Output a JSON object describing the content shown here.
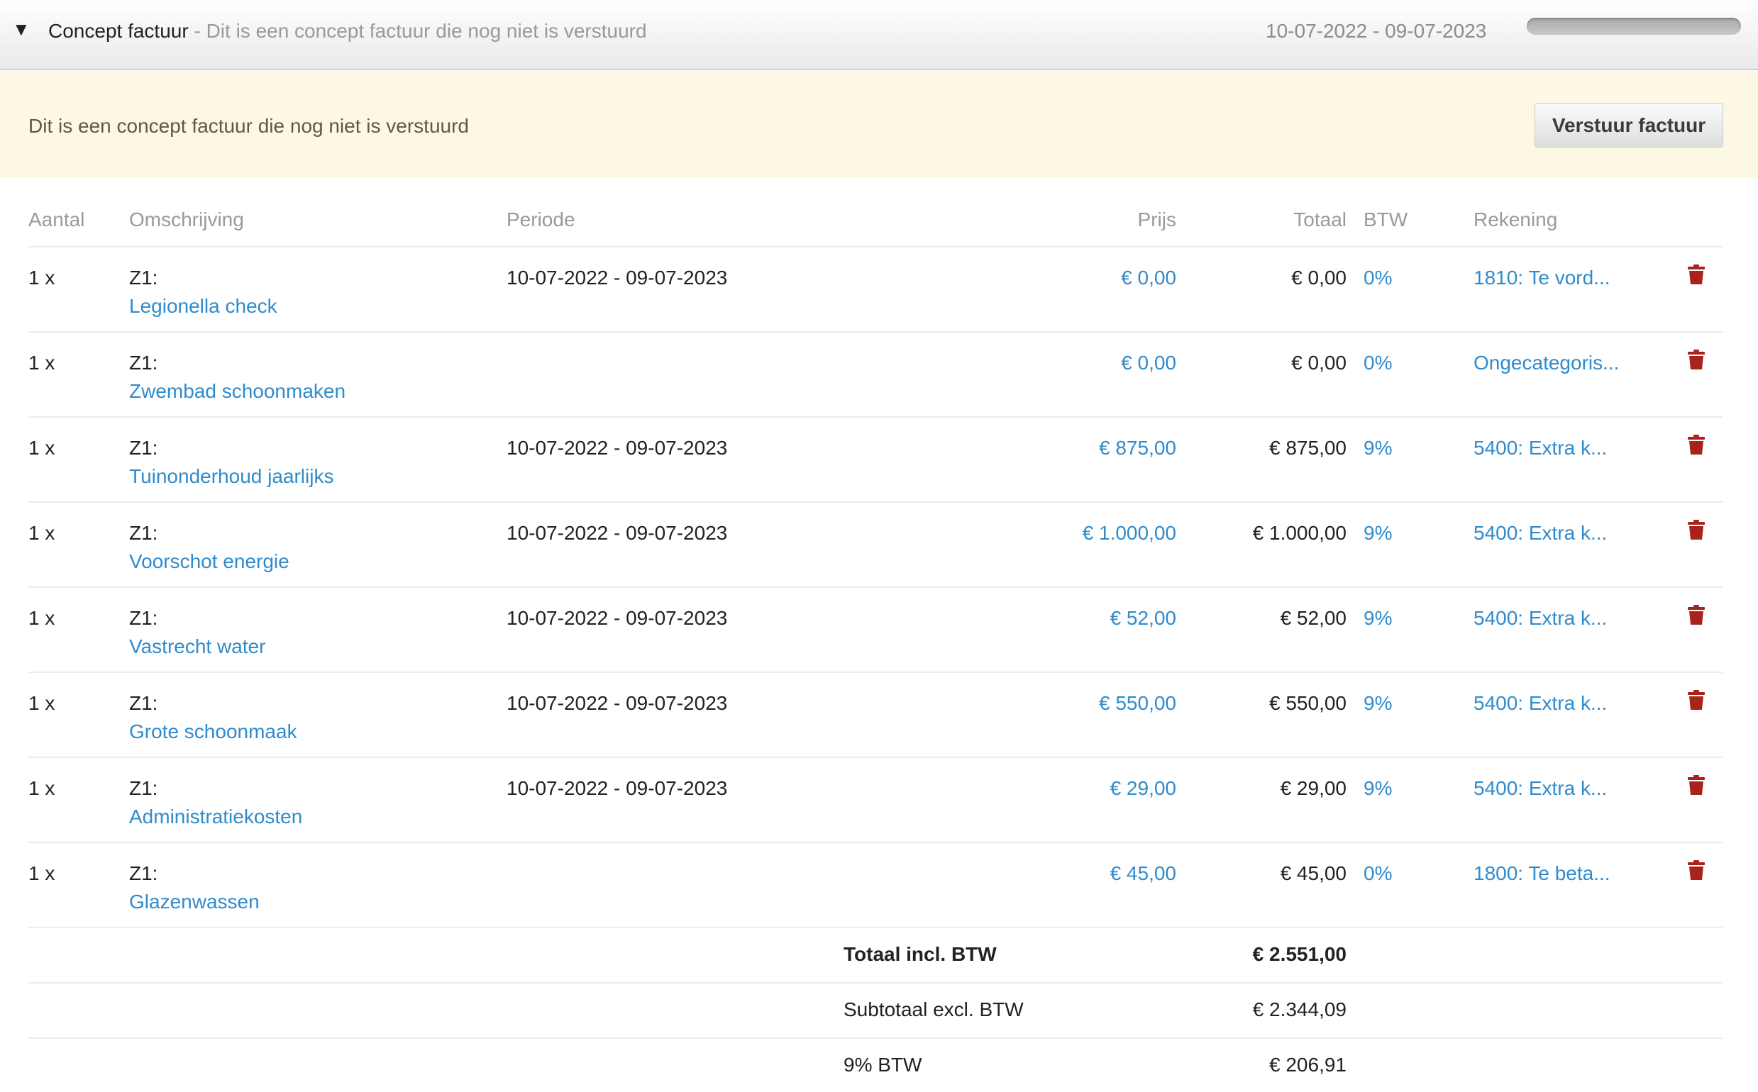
{
  "header": {
    "title": "Concept factuur",
    "separator": " - ",
    "subtitle": "Dit is een concept factuur die nog niet is verstuurd",
    "period": "10-07-2022 - 09-07-2023",
    "progress_fraction": 0
  },
  "notice": {
    "text": "Dit is een concept factuur die nog niet is verstuurd",
    "button_label": "Verstuur factuur"
  },
  "table": {
    "columns": {
      "aantal": "Aantal",
      "omschrijving": "Omschrijving",
      "periode": "Periode",
      "prijs": "Prijs",
      "totaal": "Totaal",
      "btw": "BTW",
      "rekening": "Rekening"
    },
    "rows": [
      {
        "aantal": "1 x",
        "prefix": "Z1:",
        "desc": "Legionella check",
        "periode": "10-07-2022 - 09-07-2023",
        "prijs": "€ 0,00",
        "totaal": "€ 0,00",
        "btw": "0%",
        "rekening": "1810: Te vord..."
      },
      {
        "aantal": "1 x",
        "prefix": "Z1:",
        "desc": "Zwembad schoonmaken",
        "periode": "",
        "prijs": "€ 0,00",
        "totaal": "€ 0,00",
        "btw": "0%",
        "rekening": "Ongecategoris..."
      },
      {
        "aantal": "1 x",
        "prefix": "Z1:",
        "desc": "Tuinonderhoud jaarlijks",
        "periode": "10-07-2022 - 09-07-2023",
        "prijs": "€ 875,00",
        "totaal": "€ 875,00",
        "btw": "9%",
        "rekening": "5400: Extra k..."
      },
      {
        "aantal": "1 x",
        "prefix": "Z1:",
        "desc": "Voorschot energie",
        "periode": "10-07-2022 - 09-07-2023",
        "prijs": "€ 1.000,00",
        "totaal": "€ 1.000,00",
        "btw": "9%",
        "rekening": "5400: Extra k..."
      },
      {
        "aantal": "1 x",
        "prefix": "Z1:",
        "desc": "Vastrecht water",
        "periode": "10-07-2022 - 09-07-2023",
        "prijs": "€ 52,00",
        "totaal": "€ 52,00",
        "btw": "9%",
        "rekening": "5400: Extra k..."
      },
      {
        "aantal": "1 x",
        "prefix": "Z1:",
        "desc": "Grote schoonmaak",
        "periode": "10-07-2022 - 09-07-2023",
        "prijs": "€ 550,00",
        "totaal": "€ 550,00",
        "btw": "9%",
        "rekening": "5400: Extra k..."
      },
      {
        "aantal": "1 x",
        "prefix": "Z1:",
        "desc": "Administratiekosten",
        "periode": "10-07-2022 - 09-07-2023",
        "prijs": "€ 29,00",
        "totaal": "€ 29,00",
        "btw": "9%",
        "rekening": "5400: Extra k..."
      },
      {
        "aantal": "1 x",
        "prefix": "Z1:",
        "desc": "Glazenwassen",
        "periode": "",
        "prijs": "€ 45,00",
        "totaal": "€ 45,00",
        "btw": "0%",
        "rekening": "1800: Te beta..."
      }
    ],
    "row_action_icon": "trash-icon"
  },
  "totals": [
    {
      "label": "Totaal incl. BTW",
      "value": "€ 2.551,00",
      "bold": true
    },
    {
      "label": "Subtotaal excl. BTW",
      "value": "€ 2.344,09",
      "bold": false
    },
    {
      "label": "9% BTW",
      "value": "€ 206,91",
      "bold": false
    }
  ],
  "colors": {
    "link": "#2f8bcc",
    "notice_background": "#fdf8e4",
    "delete": "#a8231b"
  }
}
